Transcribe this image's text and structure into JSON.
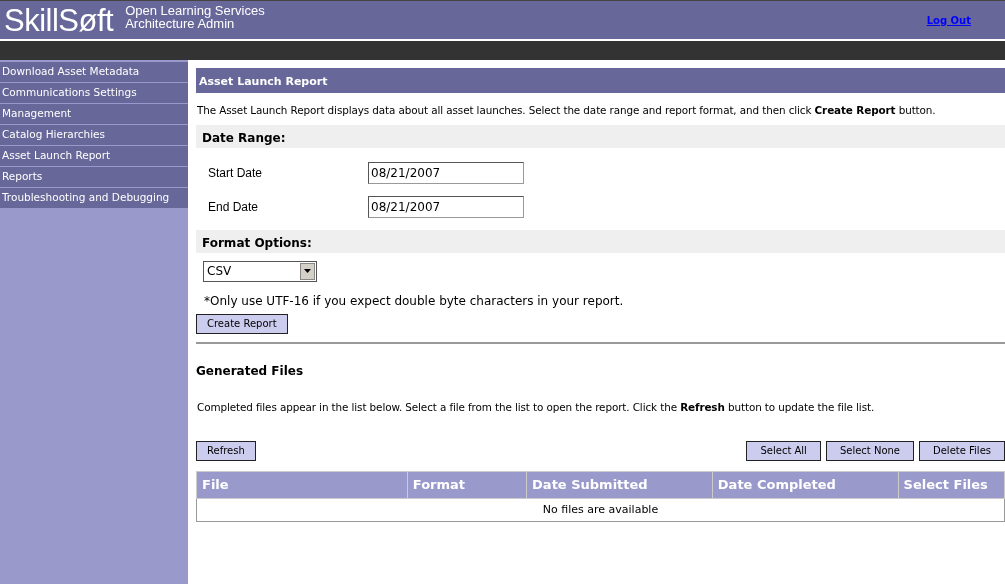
{
  "header": {
    "logo": "SkillSøft",
    "subtitle_lines": [
      "Open Learning Services",
      "Architecture Admin"
    ],
    "logout": "Log Out"
  },
  "sidebar": {
    "items": [
      {
        "label": "Download Asset Metadata"
      },
      {
        "label": "Communications Settings"
      },
      {
        "label": "Management"
      },
      {
        "label": "Catalog Hierarchies"
      },
      {
        "label": "Asset Launch Report"
      },
      {
        "label": "Reports"
      },
      {
        "label": "Troubleshooting and Debugging"
      }
    ]
  },
  "page_title": "Asset Launch Report",
  "intro": "The Asset Launch Report displays data about all asset launches. Select the date range and report format, and then click **Create Report** button.",
  "date_range": {
    "heading": "Date Range:",
    "fields": [
      {
        "label": "Start Date",
        "value": "08/21/2007"
      },
      {
        "label": "End Date",
        "value": "08/21/2007"
      }
    ]
  },
  "format_options": {
    "heading": "Format Options:",
    "value": "CSV",
    "note": "*Only use UTF-16 if you expect double byte characters in your report.",
    "button": "Create Report"
  },
  "generated_files": {
    "heading": "Generated Files",
    "intro": "Completed files appear in the list below. Select a file from the list to open the report. Click the **Refresh** button to update the file list.",
    "left_buttons": [
      "Refresh"
    ],
    "right_buttons": [
      "Select All",
      "Select None",
      "Delete Files"
    ],
    "table": {
      "columns": [
        "File",
        "Format",
        "Date Submitted",
        "Date Completed",
        "Select Files"
      ],
      "empty_message": "No files are available"
    }
  }
}
